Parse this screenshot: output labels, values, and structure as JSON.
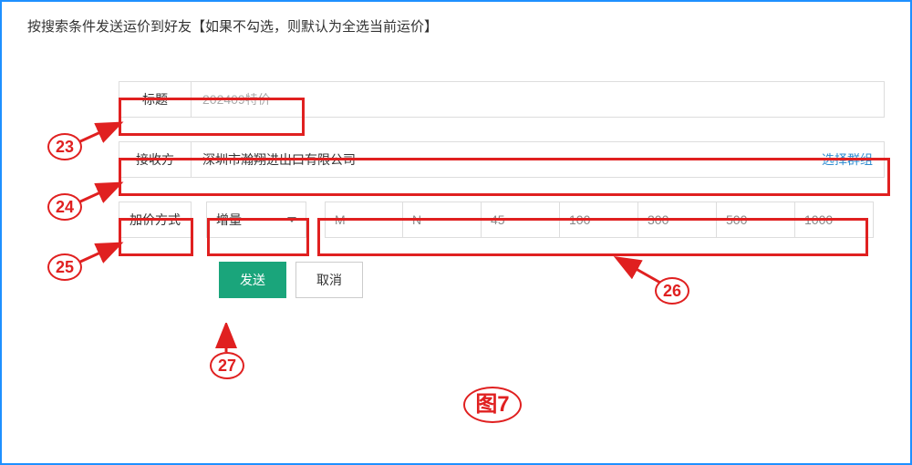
{
  "header": {
    "title": "按搜索条件发送运价到好友【如果不勾选，则默认为全选当前运价】"
  },
  "form": {
    "title_label": "标题",
    "title_value": "202409特价",
    "recipient_label": "接收方",
    "recipient_value": "深圳市瀚翔进出口有限公司",
    "select_group_link": "选择群组",
    "markup_label": "加价方式",
    "markup_select_value": "增量",
    "tiers": [
      "M",
      "N",
      "45",
      "100",
      "300",
      "500",
      "1000"
    ],
    "send_button": "发送",
    "cancel_button": "取消"
  },
  "annotations": {
    "a23": "23",
    "a24": "24",
    "a25": "25",
    "a26": "26",
    "a27": "27",
    "figure_label": "图7"
  }
}
